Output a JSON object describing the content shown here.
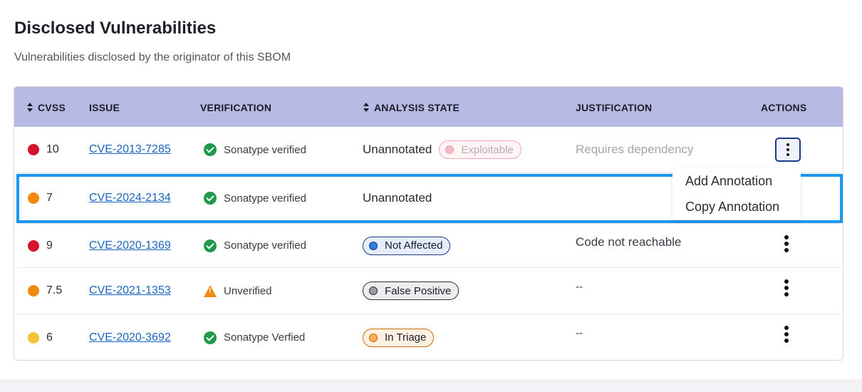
{
  "page": {
    "title": "Disclosed Vulnerabilities",
    "subtitle": "Vulnerabilities disclosed by the originator of this SBOM"
  },
  "table": {
    "headers": {
      "cvss": "CVSS",
      "issue": "ISSUE",
      "verification": "VERIFICATION",
      "analysis_state": "ANALYSIS STATE",
      "justification": "JUSTIFICATION",
      "actions": "ACTIONS"
    },
    "rows": [
      {
        "cvss": "10",
        "severity_color": "#d6122c",
        "issue": "CVE-2013-7285",
        "verification": "Sonatype verified",
        "verification_icon": "check-circle-icon",
        "analysis": "Unannotated",
        "pill": "Exploitable",
        "justification": "Requires dependency"
      },
      {
        "cvss": "7",
        "severity_color": "#f28a10",
        "issue": "CVE-2024-2134",
        "verification": "Sonatype verified",
        "verification_icon": "check-circle-icon",
        "analysis": "Unannotated",
        "justification": ""
      },
      {
        "cvss": "9",
        "severity_color": "#d6122c",
        "issue": "CVE-2020-1369",
        "verification": "Sonatype verified",
        "verification_icon": "check-circle-icon",
        "pill": "Not Affected",
        "justification": "Code not reachable"
      },
      {
        "cvss": "7.5",
        "severity_color": "#f28a10",
        "issue": "CVE-2021-1353",
        "verification": "Unverified",
        "verification_icon": "warning-icon",
        "pill": "False Positive",
        "justification": "--"
      },
      {
        "cvss": "6",
        "severity_color": "#f8c235",
        "issue": "CVE-2020-3692",
        "verification": "Sonatype Verfied",
        "verification_icon": "check-circle-icon",
        "pill": "In Triage",
        "justification": "--"
      }
    ]
  },
  "menu": {
    "items": [
      "Add Annotation",
      "Copy Annotation"
    ]
  },
  "colors": {
    "header_bg": "#b7bbe3",
    "link": "#1c65c2",
    "highlight": "#1a98f0",
    "verified": "#1f9a4a",
    "warning": "#f28b12"
  }
}
